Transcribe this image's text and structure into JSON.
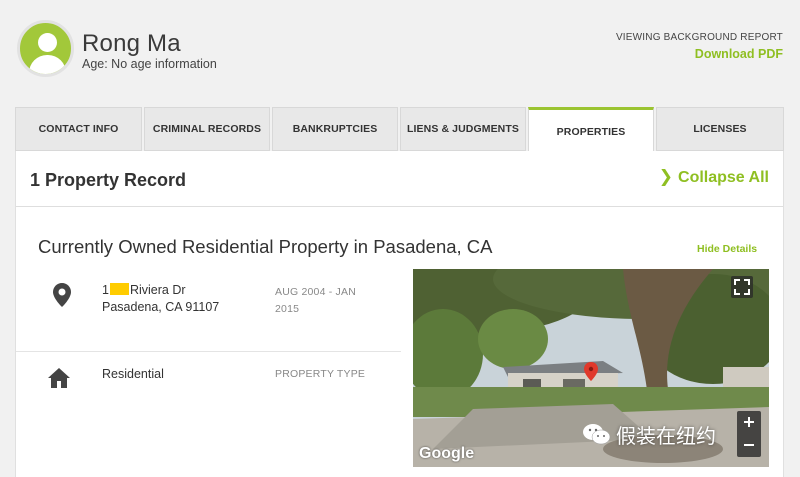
{
  "header": {
    "name": "Rong Ma",
    "age": "Age: No age information",
    "viewing": "VIEWING BACKGROUND REPORT",
    "download": "Download PDF"
  },
  "tabs": [
    {
      "label": "CONTACT INFO",
      "active": false
    },
    {
      "label": "CRIMINAL RECORDS",
      "active": false
    },
    {
      "label": "BANKRUPTCIES",
      "active": false
    },
    {
      "label": "LIENS & JUDGMENTS",
      "active": false
    },
    {
      "label": "PROPERTIES",
      "active": true
    },
    {
      "label": "LICENSES",
      "active": false
    }
  ],
  "records": {
    "count_label": "1 Property Record",
    "collapse_label": "Collapse All"
  },
  "property": {
    "title": "Currently Owned Residential Property in Pasadena, CA",
    "hide_details": "Hide Details",
    "address_prefix": "1",
    "address_street": "Riviera Dr",
    "address_city": "Pasadena, CA 91107",
    "date_range": "AUG 2004 - JAN 2015",
    "type_value": "Residential",
    "type_label": "PROPERTY TYPE"
  },
  "streetview": {
    "logo": "Google"
  },
  "watermark": {
    "text": "假装在纽约"
  },
  "colors": {
    "accent": "#8fbf22",
    "avatar": "#a2c83a",
    "redaction": "#ffcc00"
  }
}
